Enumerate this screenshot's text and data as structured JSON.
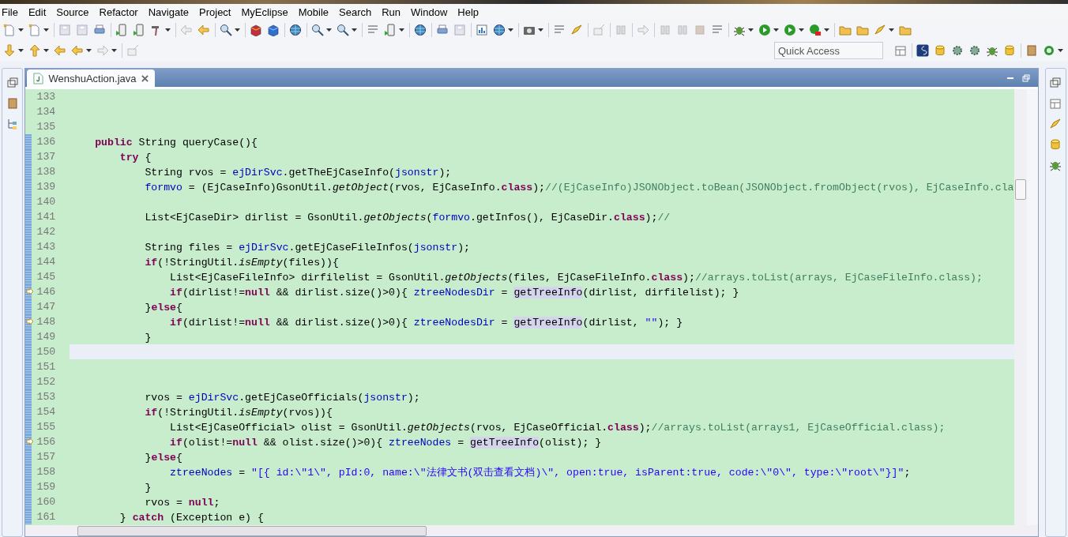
{
  "menu": [
    "File",
    "Edit",
    "Source",
    "Refactor",
    "Navigate",
    "Project",
    "MyEclipse",
    "Mobile",
    "Search",
    "Run",
    "Window",
    "Help"
  ],
  "quick_access": {
    "placeholder": "Quick Access"
  },
  "editor": {
    "tabs": [
      {
        "label": "WenshuAction.java",
        "selected": true
      }
    ],
    "lines": [
      {
        "number": "133",
        "changed": false,
        "current": false,
        "annotation": false
      },
      {
        "number": "134",
        "changed": false,
        "current": false,
        "annotation": false
      },
      {
        "number": "135",
        "changed": false,
        "current": false,
        "annotation": false
      },
      {
        "number": "136",
        "changed": true,
        "current": false,
        "annotation": false,
        "tokens": [
          {
            "kind": "keyword",
            "text": "    public"
          },
          {
            "kind": "plain",
            "text": " String queryCase(){"
          }
        ]
      },
      {
        "number": "137",
        "changed": true,
        "current": false,
        "annotation": false,
        "tokens": [
          {
            "kind": "keyword",
            "text": "        try"
          },
          {
            "kind": "plain",
            "text": " {"
          }
        ]
      },
      {
        "number": "138",
        "changed": true,
        "current": false,
        "annotation": false,
        "tokens": [
          {
            "kind": "plain",
            "text": "            String rvos = "
          },
          {
            "kind": "field",
            "text": "ejDirSvc"
          },
          {
            "kind": "plain",
            "text": ".getTheEjCaseInfo("
          },
          {
            "kind": "field",
            "text": "jsonstr"
          },
          {
            "kind": "plain",
            "text": ");"
          }
        ]
      },
      {
        "number": "139",
        "changed": true,
        "current": false,
        "annotation": false,
        "tokens": [
          {
            "kind": "field",
            "text": "            formvo"
          },
          {
            "kind": "plain",
            "text": " = (EjCaseInfo)GsonUtil."
          },
          {
            "kind": "static",
            "text": "getObject"
          },
          {
            "kind": "plain",
            "text": "(rvos, EjCaseInfo."
          },
          {
            "kind": "keyword",
            "text": "class"
          },
          {
            "kind": "plain",
            "text": ");"
          },
          {
            "kind": "comment",
            "text": "//(EjCaseInfo)JSONObject.toBean(JSONObject.fromObject(rvos), EjCaseInfo.cla"
          }
        ]
      },
      {
        "number": "140",
        "changed": true,
        "current": false,
        "annotation": false
      },
      {
        "number": "141",
        "changed": true,
        "current": false,
        "annotation": false,
        "tokens": [
          {
            "kind": "plain",
            "text": "            List<EjCaseDir> dirlist = GsonUtil."
          },
          {
            "kind": "static",
            "text": "getObjects"
          },
          {
            "kind": "plain",
            "text": "("
          },
          {
            "kind": "field",
            "text": "formvo"
          },
          {
            "kind": "plain",
            "text": ".getInfos(), EjCaseDir."
          },
          {
            "kind": "keyword",
            "text": "class"
          },
          {
            "kind": "plain",
            "text": ");"
          },
          {
            "kind": "comment",
            "text": "//"
          }
        ]
      },
      {
        "number": "142",
        "changed": true,
        "current": false,
        "annotation": false
      },
      {
        "number": "143",
        "changed": true,
        "current": false,
        "annotation": false,
        "tokens": [
          {
            "kind": "plain",
            "text": "            String files = "
          },
          {
            "kind": "field",
            "text": "ejDirSvc"
          },
          {
            "kind": "plain",
            "text": ".getEjCaseFileInfos("
          },
          {
            "kind": "field",
            "text": "jsonstr"
          },
          {
            "kind": "plain",
            "text": ");"
          }
        ]
      },
      {
        "number": "144",
        "changed": true,
        "current": false,
        "annotation": false,
        "tokens": [
          {
            "kind": "keyword",
            "text": "            if"
          },
          {
            "kind": "plain",
            "text": "(!StringUtil."
          },
          {
            "kind": "static",
            "text": "isEmpty"
          },
          {
            "kind": "plain",
            "text": "(files)){"
          }
        ]
      },
      {
        "number": "145",
        "changed": true,
        "current": false,
        "annotation": false,
        "tokens": [
          {
            "kind": "plain",
            "text": "                List<EjCaseFileInfo> dirfilelist = GsonUtil."
          },
          {
            "kind": "static",
            "text": "getObjects"
          },
          {
            "kind": "plain",
            "text": "(files, EjCaseFileInfo."
          },
          {
            "kind": "keyword",
            "text": "class"
          },
          {
            "kind": "plain",
            "text": ");"
          },
          {
            "kind": "comment",
            "text": "//arrays.toList(arrays, EjCaseFileInfo.class);"
          }
        ]
      },
      {
        "number": "146",
        "changed": true,
        "current": false,
        "annotation": true,
        "tokens": [
          {
            "kind": "keyword",
            "text": "                if"
          },
          {
            "kind": "plain",
            "text": "(dirlist!="
          },
          {
            "kind": "keyword",
            "text": "null"
          },
          {
            "kind": "plain",
            "text": " && dirlist.size()>0){ "
          },
          {
            "kind": "field",
            "text": "ztreeNodesDir"
          },
          {
            "kind": "plain",
            "text": " = "
          },
          {
            "kind": "occurrence",
            "text": "getTreeInfo"
          },
          {
            "kind": "plain",
            "text": "(dirlist, dirfilelist); }"
          }
        ]
      },
      {
        "number": "147",
        "changed": true,
        "current": false,
        "annotation": false,
        "tokens": [
          {
            "kind": "plain",
            "text": "            }"
          },
          {
            "kind": "keyword",
            "text": "else"
          },
          {
            "kind": "plain",
            "text": "{"
          }
        ]
      },
      {
        "number": "148",
        "changed": true,
        "current": false,
        "annotation": true,
        "tokens": [
          {
            "kind": "keyword",
            "text": "                if"
          },
          {
            "kind": "plain",
            "text": "(dirlist!="
          },
          {
            "kind": "keyword",
            "text": "null"
          },
          {
            "kind": "plain",
            "text": " && dirlist.size()>0){ "
          },
          {
            "kind": "field",
            "text": "ztreeNodesDir"
          },
          {
            "kind": "plain",
            "text": " = "
          },
          {
            "kind": "occurrence",
            "text": "getTreeInfo"
          },
          {
            "kind": "plain",
            "text": "(dirlist, "
          },
          {
            "kind": "string",
            "text": "\"\""
          },
          {
            "kind": "plain",
            "text": "); }"
          }
        ]
      },
      {
        "number": "149",
        "changed": true,
        "current": false,
        "annotation": false,
        "tokens": [
          {
            "kind": "plain",
            "text": "            }"
          }
        ]
      },
      {
        "number": "150",
        "changed": true,
        "current": true,
        "annotation": false
      },
      {
        "number": "151",
        "changed": true,
        "current": false,
        "annotation": false
      },
      {
        "number": "152",
        "changed": true,
        "current": false,
        "annotation": false
      },
      {
        "number": "153",
        "changed": true,
        "current": false,
        "annotation": false,
        "tokens": [
          {
            "kind": "plain",
            "text": "            rvos = "
          },
          {
            "kind": "field",
            "text": "ejDirSvc"
          },
          {
            "kind": "plain",
            "text": ".getEjCaseOfficials("
          },
          {
            "kind": "field",
            "text": "jsonstr"
          },
          {
            "kind": "plain",
            "text": ");"
          }
        ]
      },
      {
        "number": "154",
        "changed": true,
        "current": false,
        "annotation": false,
        "tokens": [
          {
            "kind": "keyword",
            "text": "            if"
          },
          {
            "kind": "plain",
            "text": "(!StringUtil."
          },
          {
            "kind": "static",
            "text": "isEmpty"
          },
          {
            "kind": "plain",
            "text": "(rvos)){"
          }
        ]
      },
      {
        "number": "155",
        "changed": true,
        "current": false,
        "annotation": false,
        "tokens": [
          {
            "kind": "plain",
            "text": "                List<EjCaseOfficial> olist = GsonUtil."
          },
          {
            "kind": "static",
            "text": "getObjects"
          },
          {
            "kind": "plain",
            "text": "(rvos, EjCaseOfficial."
          },
          {
            "kind": "keyword",
            "text": "class"
          },
          {
            "kind": "plain",
            "text": ");"
          },
          {
            "kind": "comment",
            "text": "//arrays.toList(arrays1, EjCaseOfficial.class);"
          }
        ]
      },
      {
        "number": "156",
        "changed": true,
        "current": false,
        "annotation": true,
        "tokens": [
          {
            "kind": "keyword",
            "text": "                if"
          },
          {
            "kind": "plain",
            "text": "(olist!="
          },
          {
            "kind": "keyword",
            "text": "null"
          },
          {
            "kind": "plain",
            "text": " && olist.size()>0){ "
          },
          {
            "kind": "field",
            "text": "ztreeNodes"
          },
          {
            "kind": "plain",
            "text": " = "
          },
          {
            "kind": "occurrence",
            "text": "getTreeInfo"
          },
          {
            "kind": "plain",
            "text": "(olist); }"
          }
        ]
      },
      {
        "number": "157",
        "changed": true,
        "current": false,
        "annotation": false,
        "tokens": [
          {
            "kind": "plain",
            "text": "            }"
          },
          {
            "kind": "keyword",
            "text": "else"
          },
          {
            "kind": "plain",
            "text": "{"
          }
        ]
      },
      {
        "number": "158",
        "changed": true,
        "current": false,
        "annotation": false,
        "tokens": [
          {
            "kind": "field",
            "text": "                ztreeNodes"
          },
          {
            "kind": "plain",
            "text": " = "
          },
          {
            "kind": "string",
            "text": "\"[{ id:\\\"1\\\", pId:0, name:\\\"法律文书(双击查看文档)\\\", open:true, isParent:true, code:\\\"0\\\", type:\\\"root\\\"}]\""
          },
          {
            "kind": "plain",
            "text": ";"
          }
        ]
      },
      {
        "number": "159",
        "changed": true,
        "current": false,
        "annotation": false,
        "tokens": [
          {
            "kind": "plain",
            "text": "            }"
          }
        ]
      },
      {
        "number": "160",
        "changed": true,
        "current": false,
        "annotation": false,
        "tokens": [
          {
            "kind": "plain",
            "text": "            rvos = "
          },
          {
            "kind": "keyword",
            "text": "null"
          },
          {
            "kind": "plain",
            "text": ";"
          }
        ]
      },
      {
        "number": "161",
        "changed": true,
        "current": false,
        "annotation": false,
        "tokens": [
          {
            "kind": "plain",
            "text": "        } "
          },
          {
            "kind": "keyword",
            "text": "catch"
          },
          {
            "kind": "plain",
            "text": " (Exception e) {"
          }
        ]
      }
    ]
  }
}
